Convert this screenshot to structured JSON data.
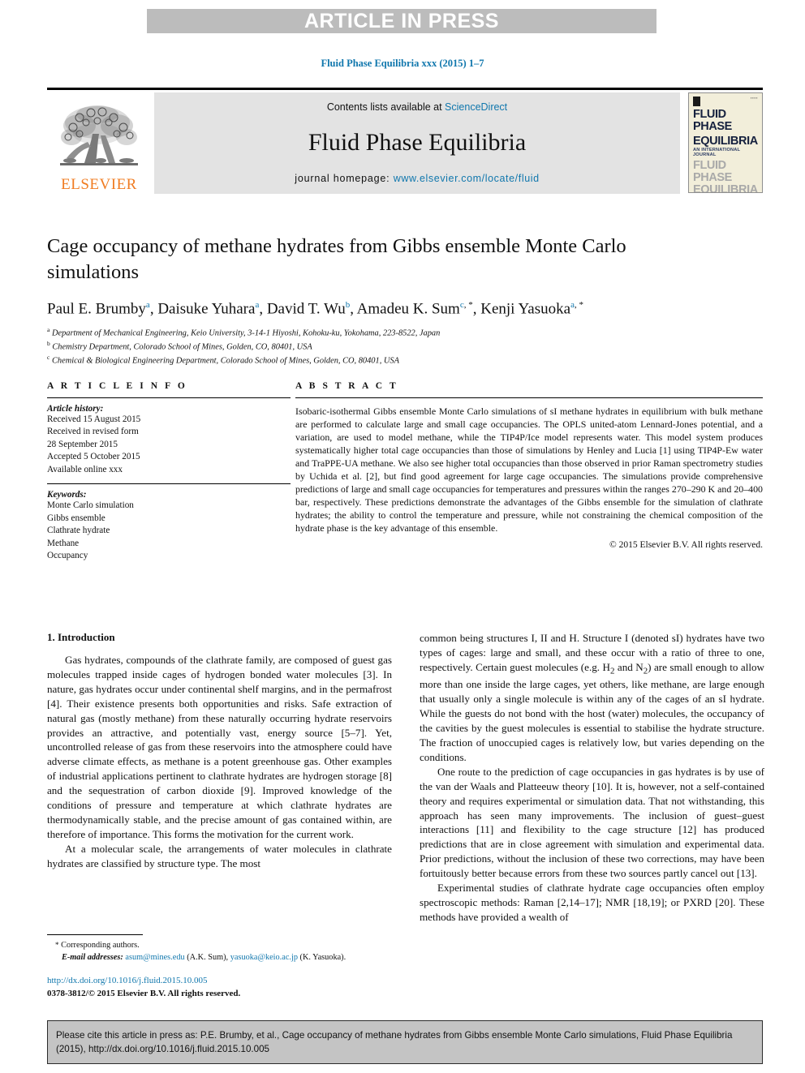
{
  "banner": {
    "text": "ARTICLE IN PRESS"
  },
  "journal_ref": "Fluid Phase Equilibria xxx (2015) 1–7",
  "masthead": {
    "contents_prefix": "Contents lists available at ",
    "sciencedirect": "ScienceDirect",
    "journal_title": "Fluid Phase Equilibria",
    "homepage_prefix": "journal homepage: ",
    "homepage_url": "www.elsevier.com/locate/fluid",
    "publisher": "ELSEVIER",
    "cover": {
      "line1": "FLUID PHASE",
      "line2": "EQUILIBRIA",
      "subtitle": "AN INTERNATIONAL JOURNAL",
      "line3": "FLUID PHASE",
      "line4": "EQUILIBRIA"
    }
  },
  "article": {
    "title": "Cage occupancy of methane hydrates from Gibbs ensemble Monte Carlo simulations",
    "authors": [
      {
        "name": "Paul E. Brumby",
        "marks": [
          "a"
        ],
        "star": false
      },
      {
        "name": "Daisuke Yuhara",
        "marks": [
          "a"
        ],
        "star": false
      },
      {
        "name": "David T. Wu",
        "marks": [
          "b"
        ],
        "star": false
      },
      {
        "name": "Amadeu K. Sum",
        "marks": [
          "c"
        ],
        "star": true
      },
      {
        "name": "Kenji Yasuoka",
        "marks": [
          "a"
        ],
        "star": true
      }
    ],
    "affiliations": [
      {
        "mark": "a",
        "text": "Department of Mechanical Engineering, Keio University, 3-14-1 Hiyoshi, Kohoku-ku, Yokohama, 223-8522, Japan"
      },
      {
        "mark": "b",
        "text": "Chemistry Department, Colorado School of Mines, Golden, CO, 80401, USA"
      },
      {
        "mark": "c",
        "text": "Chemical & Biological Engineering Department, Colorado School of Mines, Golden, CO, 80401, USA"
      }
    ]
  },
  "info": {
    "heading": "A R T I C L E   I N F O",
    "history_title": "Article history:",
    "history": [
      "Received 15 August 2015",
      "Received in revised form",
      "28 September 2015",
      "Accepted 5 October 2015",
      "Available online xxx"
    ],
    "keywords_title": "Keywords:",
    "keywords": [
      "Monte Carlo simulation",
      "Gibbs ensemble",
      "Clathrate hydrate",
      "Methane",
      "Occupancy"
    ]
  },
  "abstract": {
    "heading": "A B S T R A C T",
    "text": "Isobaric-isothermal Gibbs ensemble Monte Carlo simulations of sI methane hydrates in equilibrium with bulk methane are performed to calculate large and small cage occupancies. The OPLS united-atom Lennard-Jones potential, and a variation, are used to model methane, while the TIP4P/Ice model represents water. This model system produces systematically higher total cage occupancies than those of simulations by Henley and Lucia [1] using TIP4P-Ew water and TraPPE-UA methane. We also see higher total occupancies than those observed in prior Raman spectrometry studies by Uchida et al. [2], but find good agreement for large cage occupancies. The simulations provide comprehensive predictions of large and small cage occupancies for temperatures and pressures within the ranges 270–290 K and 20–400 bar, respectively. These predictions demonstrate the advantages of the Gibbs ensemble for the simulation of clathrate hydrates; the ability to control the temperature and pressure, while not constraining the chemical composition of the hydrate phase is the key advantage of this ensemble.",
    "copyright": "© 2015 Elsevier B.V. All rights reserved."
  },
  "body": {
    "section_title": "1. Introduction",
    "left_paragraphs": [
      "Gas hydrates, compounds of the clathrate family, are composed of guest gas molecules trapped inside cages of hydrogen bonded water molecules [3]. In nature, gas hydrates occur under continental shelf margins, and in the permafrost [4]. Their existence presents both opportunities and risks. Safe extraction of natural gas (mostly methane) from these naturally occurring hydrate reservoirs provides an attractive, and potentially vast, energy source [5–7]. Yet, uncontrolled release of gas from these reservoirs into the atmosphere could have adverse climate effects, as methane is a potent greenhouse gas. Other examples of industrial applications pertinent to clathrate hydrates are hydrogen storage [8] and the sequestration of carbon dioxide [9]. Improved knowledge of the conditions of pressure and temperature at which clathrate hydrates are thermodynamically stable, and the precise amount of gas contained within, are therefore of importance. This forms the motivation for the current work.",
      "At a molecular scale, the arrangements of water molecules in clathrate hydrates are classified by structure type. The most"
    ],
    "right_paragraphs": [
      "common being structures I, II and H. Structure I (denoted sI) hydrates have two types of cages: large and small, and these occur with a ratio of three to one, respectively. Certain guest molecules (e.g. H2 and N2) are small enough to allow more than one inside the large cages, yet others, like methane, are large enough that usually only a single molecule is within any of the cages of an sI hydrate. While the guests do not bond with the host (water) molecules, the occupancy of the cavities by the guest molecules is essential to stabilise the hydrate structure. The fraction of unoccupied cages is relatively low, but varies depending on the conditions.",
      "One route to the prediction of cage occupancies in gas hydrates is by use of the van der Waals and Platteeuw theory [10]. It is, however, not a self-contained theory and requires experimental or simulation data. That not withstanding, this approach has seen many improvements. The inclusion of guest–guest interactions [11] and flexibility to the cage structure [12] has produced predictions that are in close agreement with simulation and experimental data. Prior predictions, without the inclusion of these two corrections, may have been fortuitously better because errors from these two sources partly cancel out [13].",
      "Experimental studies of clathrate hydrate cage occupancies often employ spectroscopic methods: Raman [2,14–17]; NMR [18,19]; or PXRD [20]. These methods have provided a wealth of"
    ]
  },
  "footnote": {
    "corresponding": "Corresponding authors.",
    "email_label": "E-mail addresses:",
    "email1": "asum@mines.edu",
    "email1_owner": "(A.K. Sum),",
    "email2": "yasuoka@keio.ac.jp",
    "email2_owner": "(K. Yasuoka).",
    "doi": "http://dx.doi.org/10.1016/j.fluid.2015.10.005",
    "issn": "0378-3812/© 2015 Elsevier B.V. All rights reserved."
  },
  "cite_box": {
    "text": "Please cite this article in press as: P.E. Brumby, et al., Cage occupancy of methane hydrates from Gibbs ensemble Monte Carlo simulations, Fluid Phase Equilibria (2015), http://dx.doi.org/10.1016/j.fluid.2015.10.005"
  },
  "colors": {
    "link": "#1077ad",
    "banner_bg": "#bcbcbc",
    "masthead_bg": "#e3e3e3",
    "elsevier_orange": "#f07c22",
    "cite_bg": "#c4c4c4"
  }
}
